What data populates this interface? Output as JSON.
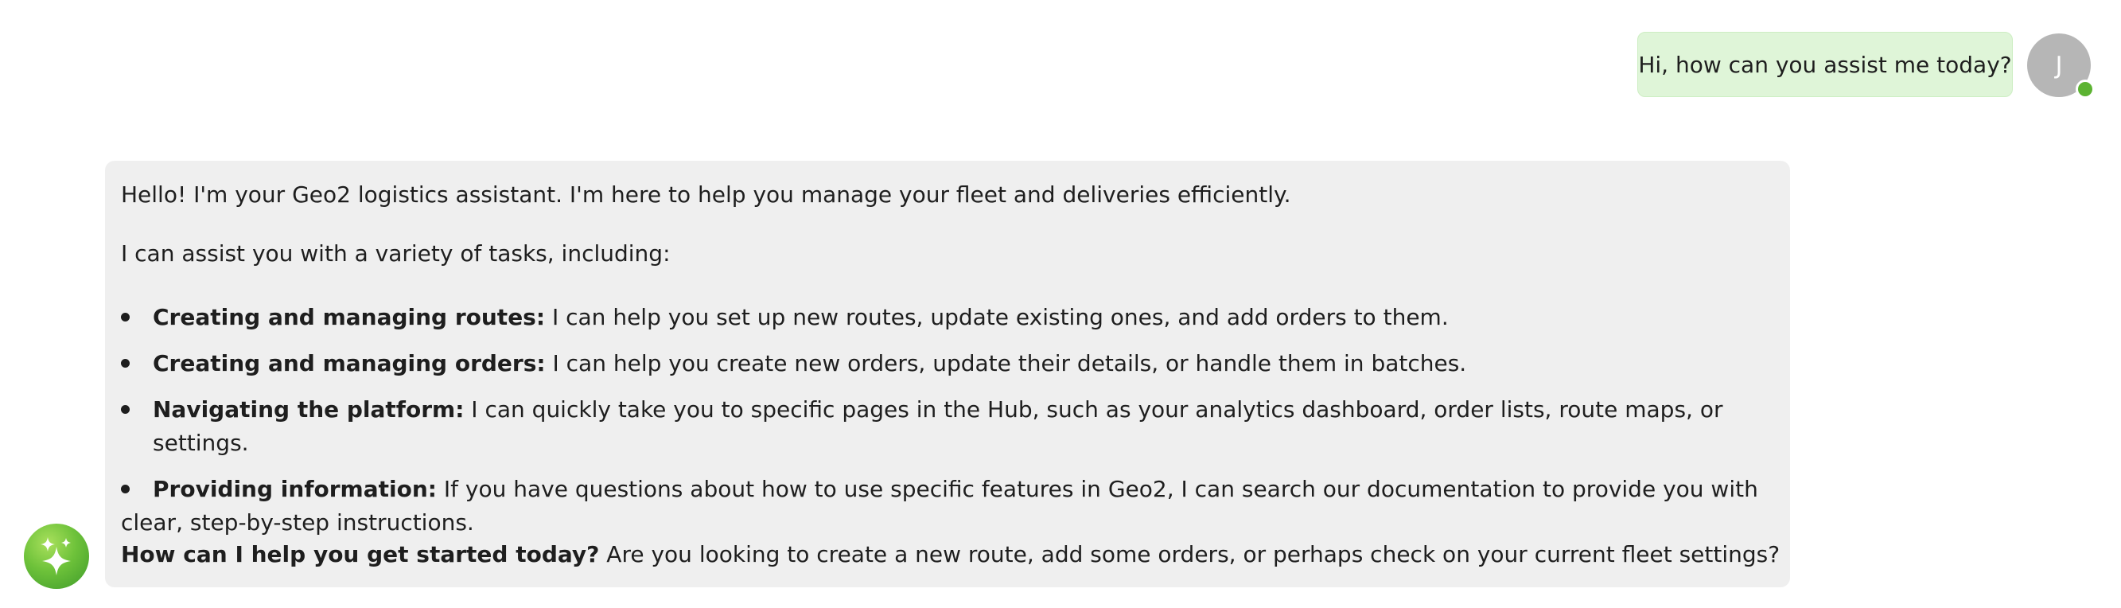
{
  "user_message": {
    "text": "Hi, how can you assist me today?",
    "avatar_initial": "J",
    "status": "online",
    "status_color": "#5cb332"
  },
  "assistant_message": {
    "intro": "Hello! I'm your Geo2 logistics assistant. I'm here to help you manage your fleet and deliveries efficiently.",
    "assist_line": "I can assist you with a variety of tasks, including:",
    "features": [
      {
        "title": "Creating and managing routes:",
        "text": " I can help you set up new routes, update existing ones, and add orders to them."
      },
      {
        "title": "Creating and managing orders:",
        "text": " I can help you create new orders, update their details, or handle them in batches."
      },
      {
        "title": "Navigating the platform:",
        "text": " I can quickly take you to specific pages in the Hub, such as your analytics dashboard, order lists, route maps, or settings."
      },
      {
        "title": "Providing information:",
        "text": " If you have questions about how to use specific features in Geo2, I can search our documentation to provide you with clear, step-by-step instructions."
      }
    ],
    "closing_strong": "How can I help you get started today?",
    "closing_text": " Are you looking to create a new route, add some orders, or perhaps check on your current fleet settings?",
    "avatar_icon": "sparkles-icon"
  },
  "colors": {
    "user_bubble": "#dff5d8",
    "assistant_bubble": "#efefef",
    "user_avatar": "#b6b6b6",
    "assistant_avatar": "#6ec23a"
  }
}
